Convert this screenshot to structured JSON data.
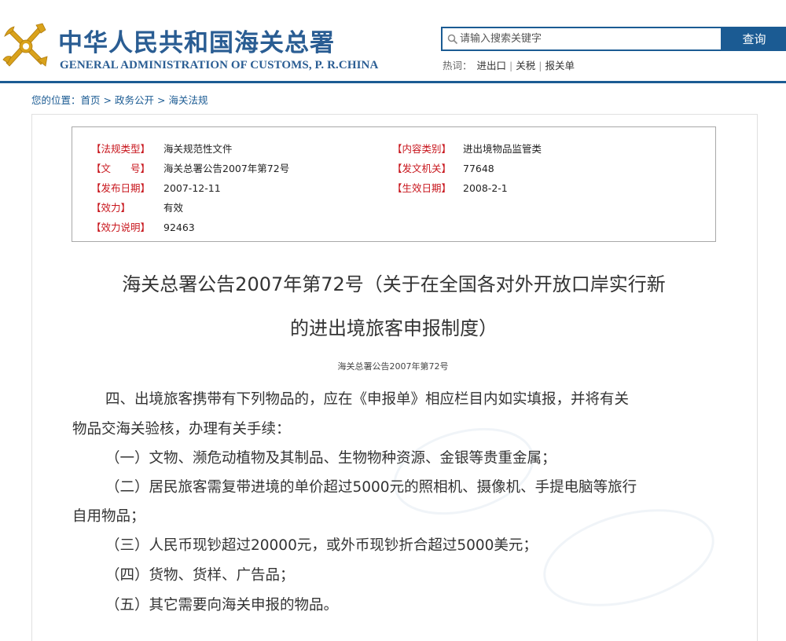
{
  "header": {
    "cn_title": "中华人民共和国海关总署",
    "en_title": "GENERAL ADMINISTRATION OF CUSTOMS, P. R.CHINA",
    "brand_color": "#1b5b93",
    "logo_icon": "customs-emblem-icon"
  },
  "search": {
    "placeholder": "请输入搜索关键字",
    "button_label": "查询"
  },
  "hotwords": {
    "label": "热词：",
    "items": [
      "进出口",
      "关税",
      "报关单"
    ]
  },
  "breadcrumb": {
    "prefix": "您的位置：",
    "items": [
      "首页",
      "政务公开",
      "海关法规"
    ],
    "separator": ">"
  },
  "meta": {
    "law_type_label": "【法规类型】",
    "law_type": "海关规范性文件",
    "doc_no_label": "【文　　号】",
    "doc_no": "海关总署公告2007年第72号",
    "issue_date_label": "【发布日期】",
    "issue_date": "2007-12-11",
    "validity_label": "【效力】",
    "validity": "有效",
    "validity_note_label": "【效力说明】",
    "validity_note": "92463",
    "category_label": "【内容类别】",
    "category": "进出境物品监管类",
    "issuer_label": "【发文机关】",
    "issuer": "77648",
    "effective_date_label": "【生效日期】",
    "effective_date": "2008-2-1",
    "label_color": "#c8161d"
  },
  "article": {
    "title_line1": "海关总署公告2007年第72号（关于在全国各对外开放口岸实行新",
    "title_line2": "的进出境旅客申报制度）",
    "subtitle": "海关总署公告2007年第72号",
    "p1_line1": "四、出境旅客携带有下列物品的，应在《申报单》相应栏目内如实填报，并将有关",
    "p1_line2": "物品交海关验核，办理有关手续：",
    "item1": "（一）文物、濒危动植物及其制品、生物物种资源、金银等贵重金属；",
    "item2_line1": "（二）居民旅客需复带进境的单价超过5000元的照相机、摄像机、手提电脑等旅行",
    "item2_line2": "自用物品；",
    "item3": "（三）人民币现钞超过20000元，或外币现钞折合超过5000美元；",
    "item4": "（四）货物、货样、广告品；",
    "item5": "（五）其它需要向海关申报的物品。"
  }
}
